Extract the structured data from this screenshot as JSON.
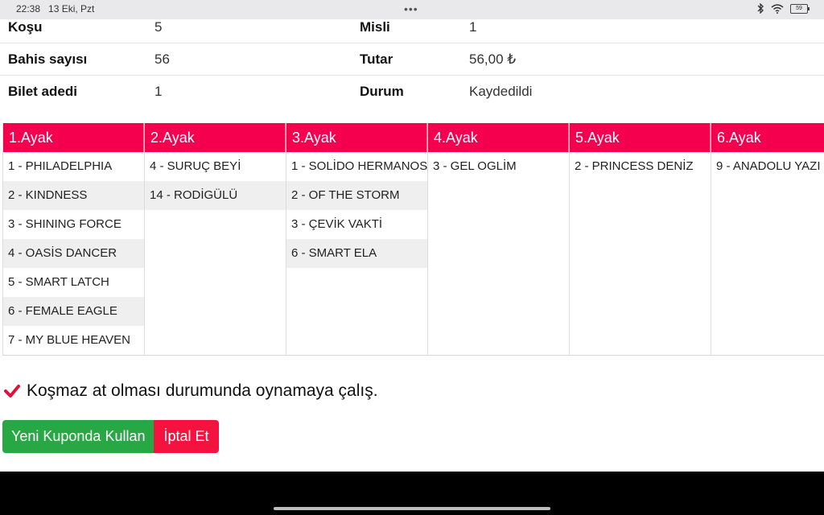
{
  "status_bar": {
    "time": "22:38",
    "date": "13 Eki, Pzt",
    "dots": "•••",
    "battery": "59",
    "icons": [
      "bluetooth-icon",
      "wifi-icon",
      "battery-icon"
    ]
  },
  "info": {
    "rows": [
      {
        "label1": "Koşu",
        "value1": "5",
        "label2": "Misli",
        "value2": "1"
      },
      {
        "label1": "Bahis sayısı",
        "value1": "56",
        "label2": "Tutar",
        "value2": "56,00 ₺"
      },
      {
        "label1": "Bilet adedi",
        "value1": "1",
        "label2": "Durum",
        "value2": "Kaydedildi"
      }
    ]
  },
  "legs": [
    {
      "title": "1.Ayak",
      "horses": [
        "1 - PHILADELPHIA",
        "2 - KINDNESS",
        "3 - SHINING FORCE",
        "4 - OASİS DANCER",
        "5 - SMART LATCH",
        "6 - FEMALE EAGLE",
        "7 - MY BLUE HEAVEN"
      ]
    },
    {
      "title": "2.Ayak",
      "horses": [
        "4 - SURUÇ BEYİ",
        "14 - RODİGÜLÜ"
      ]
    },
    {
      "title": "3.Ayak",
      "horses": [
        "1 - SOLİDO HERMANOS",
        "2 - OF THE STORM",
        "3 - ÇEVİK VAKTİ",
        "6 - SMART ELA"
      ]
    },
    {
      "title": "4.Ayak",
      "horses": [
        "3 - GEL OGLİM"
      ]
    },
    {
      "title": "5.Ayak",
      "horses": [
        "2 - PRINCESS DENİZ"
      ]
    },
    {
      "title": "6.Ayak",
      "horses": [
        "9 - ANADOLU YAZI"
      ]
    }
  ],
  "note": {
    "text": "Koşmaz at olması durumunda oynamaya çalış.",
    "checked": true,
    "check_color": "#e0103a"
  },
  "buttons": {
    "use_new": "Yeni Kuponda Kullan",
    "cancel": "İptal Et"
  },
  "colors": {
    "header": "#f4004e",
    "green": "#28a745",
    "red": "#f4133f"
  }
}
